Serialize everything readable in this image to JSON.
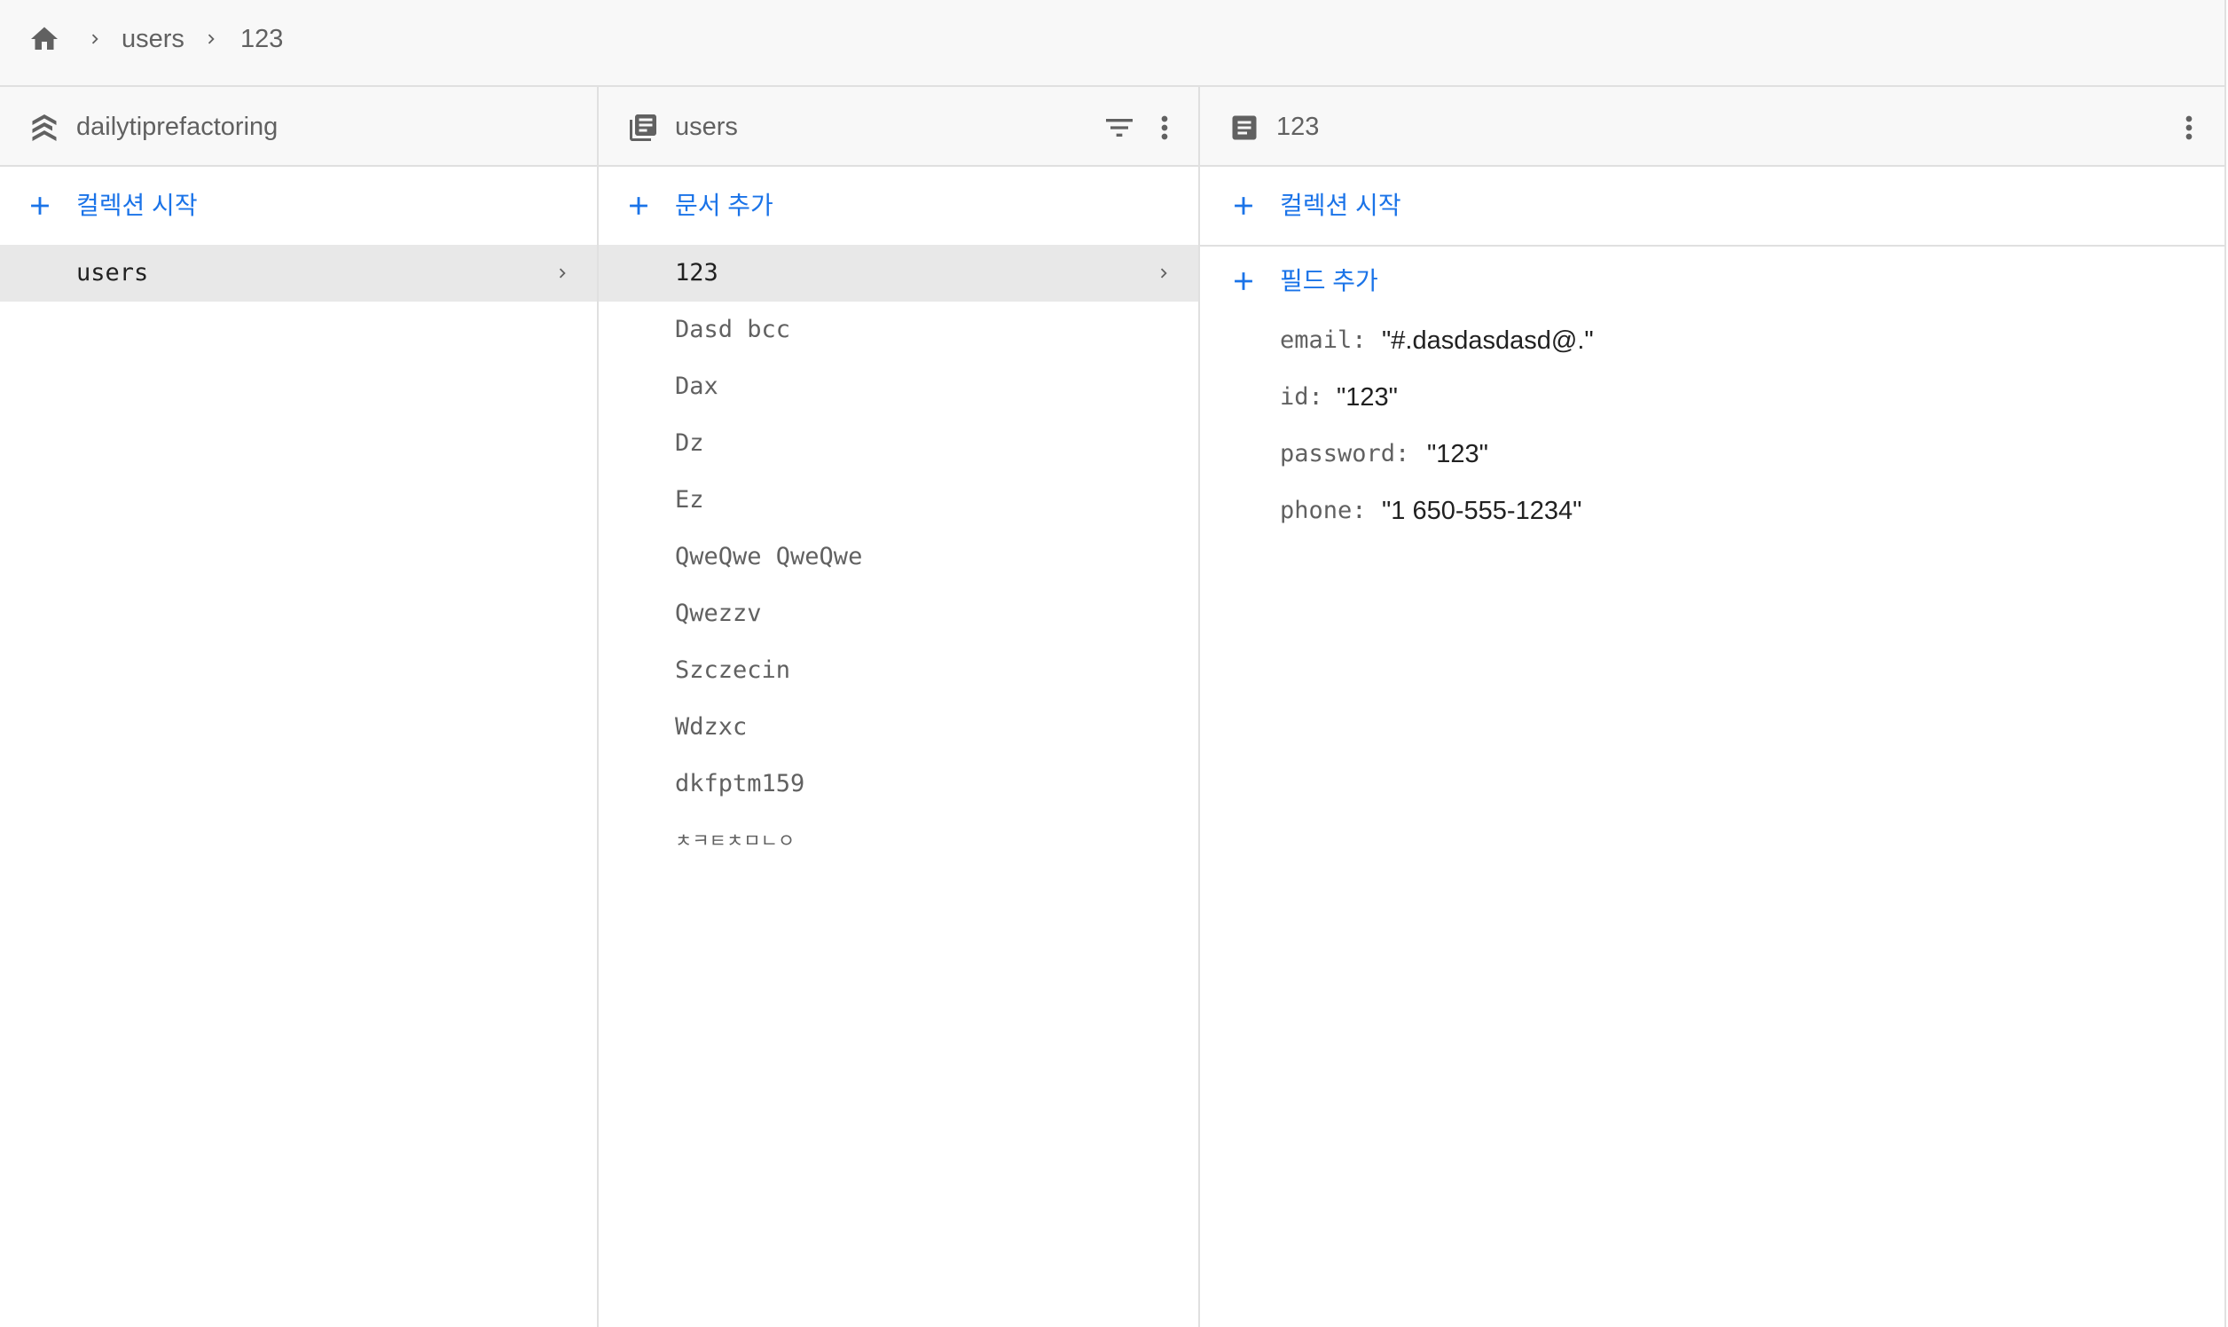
{
  "breadcrumb": {
    "home_icon": "home-icon",
    "items": [
      "users",
      "123"
    ]
  },
  "panels": {
    "root": {
      "icon": "firestore-stack-icon",
      "title": "dailytiprefactoring",
      "add_label": "컬렉션 시작",
      "items": [
        {
          "label": "users",
          "selected": true
        }
      ]
    },
    "collection": {
      "icon": "collection-icon",
      "title": "users",
      "add_label": "문서 추가",
      "actions": [
        "filter-icon",
        "more-vert-icon"
      ],
      "items": [
        {
          "label": "123",
          "selected": true
        },
        {
          "label": "Dasd bcc"
        },
        {
          "label": "Dax"
        },
        {
          "label": "Dz"
        },
        {
          "label": "Ez"
        },
        {
          "label": "QweQwe QweQwe"
        },
        {
          "label": "Qwezzv"
        },
        {
          "label": "Szczecin"
        },
        {
          "label": "Wdzxc"
        },
        {
          "label": "dkfptm159"
        },
        {
          "label": "ㅊㅋㅌㅊㅁㄴㅇ"
        }
      ]
    },
    "document": {
      "icon": "document-icon",
      "title": "123",
      "actions": [
        "more-vert-icon"
      ],
      "add_collection_label": "컬렉션 시작",
      "add_field_label": "필드 추가",
      "fields": [
        {
          "key": "email:",
          "value": "\"#.dasdasdasd@.\""
        },
        {
          "key": "id:",
          "value": "\"123\""
        },
        {
          "key": "password:",
          "value": "\"123\""
        },
        {
          "key": "phone:",
          "value": "\"1 650-555-1234\""
        }
      ]
    }
  },
  "colors": {
    "accent": "#1a73e8",
    "header_bg": "#f8f8f8",
    "selected_bg": "#e8e8e8",
    "border": "#e0e0e0",
    "text_secondary": "#616161",
    "text_primary": "#212121"
  }
}
